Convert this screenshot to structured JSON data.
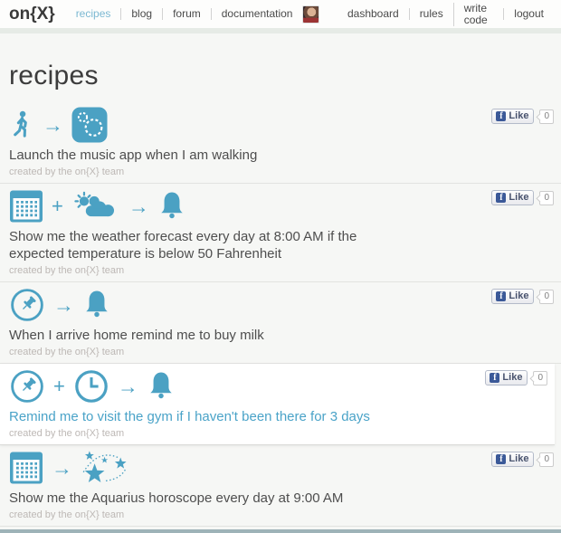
{
  "header": {
    "logo": "on{X}",
    "nav": [
      {
        "label": "recipes",
        "active": true
      },
      {
        "label": "blog",
        "active": false
      },
      {
        "label": "forum",
        "active": false
      },
      {
        "label": "documentation",
        "active": false
      }
    ],
    "user_nav": [
      {
        "label": "dashboard"
      },
      {
        "label": "rules"
      },
      {
        "label": "write code"
      },
      {
        "label": "logout"
      }
    ],
    "avatar": "user-profile-photo"
  },
  "page": {
    "title": "recipes"
  },
  "glyphs": {
    "arrow": "→",
    "plus": "+",
    "facebook_f": "f"
  },
  "like": {
    "label": "Like",
    "count": "0"
  },
  "recipes": [
    {
      "title": "Launch the music app when I am walking",
      "byline": "created by the on{X} team",
      "icons": [
        "walking-icon",
        "arrow-icon",
        "music-app-icon"
      ],
      "highlight": false
    },
    {
      "title": "Show me the weather forecast every day at 8:00 AM if the expected temperature is below 50 Fahrenheit",
      "byline": "created by the on{X} team",
      "icons": [
        "calendar-icon",
        "plus-icon",
        "weather-icon",
        "arrow-icon",
        "bell-icon"
      ],
      "highlight": false
    },
    {
      "title": "When I arrive home remind me to buy milk",
      "byline": "created by the on{X} team",
      "icons": [
        "location-pin-icon",
        "arrow-icon",
        "bell-icon"
      ],
      "highlight": false
    },
    {
      "title": "Remind me to visit the gym if I haven't been there for 3 days",
      "byline": "created by the on{X} team",
      "icons": [
        "location-pin-icon",
        "plus-icon",
        "clock-icon",
        "arrow-icon",
        "bell-icon"
      ],
      "highlight": true
    },
    {
      "title": "Show me the Aquarius horoscope every day at 9:00 AM",
      "byline": "created by the on{X} team",
      "icons": [
        "calendar-icon",
        "arrow-icon",
        "stars-icon"
      ],
      "highlight": false
    }
  ],
  "colors": {
    "accent_blue": "#4ba1c3",
    "nav_active": "#7cb8d2",
    "highlight_title": "#4aa3c8",
    "facebook_blue": "#3b5998",
    "page_bg": "#f6f7f5",
    "strip_bg": "#e6ebe6",
    "footer_band": "#9eb3b8",
    "byline_gray": "#bdb8b5"
  }
}
